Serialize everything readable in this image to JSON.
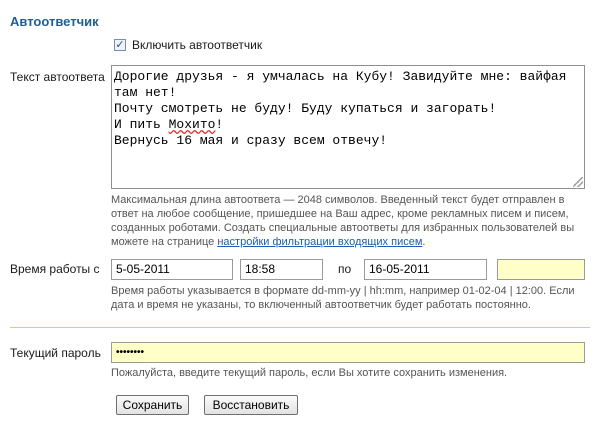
{
  "section": {
    "title": "Автоответчик"
  },
  "enable": {
    "checked": true,
    "check_glyph": "✓",
    "label": "Включить автоответчик"
  },
  "reply": {
    "label": "Текст автоответа",
    "text": "Дорогие друзья - я умчалась на Кубу! Завидуйте мне: вайфая там нет!\nПочту смотреть не буду! Буду купаться и загорать!\nИ пить Мохито!\nВернусь 16 мая и сразу всем отвечу!",
    "help_text": "Максимальная длина автоответа — 2048 символов. Введенный текст будет отправлен в ответ на любое сообщение, пришедшее на Ваш адрес, кроме рекламных писем и писем, созданных роботами. Создать специальные автоответы для избранных пользователей вы можете на странице ",
    "help_link": "настройки фильтрации входящих писем",
    "help_end": "."
  },
  "schedule": {
    "label": "Время работы с",
    "start_date": "5-05-2011",
    "start_time": "18:58",
    "to_label": "по",
    "end_date": "16-05-2011",
    "end_time": "",
    "help_text": "Время работы указывается в формате dd-mm-yy | hh:mm, например 01-02-04 | 12:00. Если дата и время не указаны, то включенный автоответчик будет работать постоянно."
  },
  "password": {
    "label": "Текущий пароль",
    "value": "••••••••",
    "help_text": "Пожалуйста, введите текущий пароль, если Вы хотите сохранить изменения."
  },
  "buttons": {
    "save": "Сохранить",
    "restore": "Восстановить"
  },
  "colors": {
    "title": "#1f5f96",
    "divider": "#f0c66a",
    "highlight_field": "#ffffc8",
    "link": "#1f5ab5"
  }
}
